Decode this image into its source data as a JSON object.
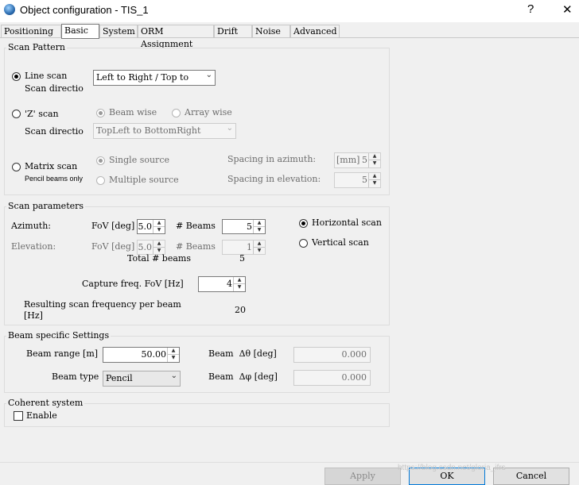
{
  "window": {
    "title": "Object configuration - TIS_1",
    "help_button": "?",
    "close_button": "✕"
  },
  "tabs": [
    "Positioning",
    "Basic",
    "System",
    "ORM Assignment",
    "Drift",
    "Noise",
    "Advanced"
  ],
  "active_tab": "Basic",
  "scan_pattern": {
    "group_label": "Scan Pattern",
    "line_scan": {
      "label": "Line scan",
      "direction_label": "Scan directio",
      "direction_value": "Left to Right / Top to"
    },
    "z_scan": {
      "label": "'Z' scan",
      "beam_wise": "Beam wise",
      "array_wise": "Array wise",
      "direction_label": "Scan directio",
      "direction_value": "TopLeft to BottomRight"
    },
    "matrix_scan": {
      "label": "Matrix scan",
      "note": "Pencil beams only",
      "single_source": "Single source",
      "multiple_source": "Multiple source",
      "spacing_azimuth_label": "Spacing in azimuth:",
      "spacing_azimuth_unit": "[mm]",
      "spacing_azimuth_value": "5",
      "spacing_elevation_label": "Spacing in elevation:",
      "spacing_elevation_value": "5"
    }
  },
  "scan_parameters": {
    "group_label": "Scan parameters",
    "azimuth_label": "Azimuth:",
    "azimuth_fov_label": "FoV [deg]",
    "azimuth_fov_value": "5.0",
    "azimuth_beams_label": "# Beams",
    "azimuth_beams_value": "5",
    "elevation_label": "Elevation:",
    "elevation_fov_label": "FoV [deg]",
    "elevation_fov_value": "5.0",
    "elevation_beams_label": "# Beams",
    "elevation_beams_value": "1",
    "total_beams_label": "Total # beams",
    "total_beams_value": "5",
    "horizontal_scan": "Horizontal scan",
    "vertical_scan": "Vertical scan",
    "capture_label": "Capture freq. FoV [Hz]",
    "capture_value": "4",
    "resulting_label_line1": "Resulting scan frequency per beam",
    "resulting_label_line2": "[Hz]",
    "resulting_value": "20"
  },
  "beam_settings": {
    "group_label": "Beam specific Settings",
    "range_label": "Beam range [m]",
    "range_value": "50.00",
    "type_label": "Beam type",
    "type_value": "Pencil",
    "theta_label": "Beam  Δθ [deg]",
    "theta_value": "0.000",
    "phi_label": "Beam  Δφ [deg]",
    "phi_value": "0.000"
  },
  "coherent": {
    "group_label": "Coherent system",
    "enable_label": "Enable"
  },
  "footer": {
    "apply": "Apply",
    "ok": "OK",
    "cancel": "Cancel",
    "watermark": "https://blog.csdn.net/gloria_ifrs"
  }
}
